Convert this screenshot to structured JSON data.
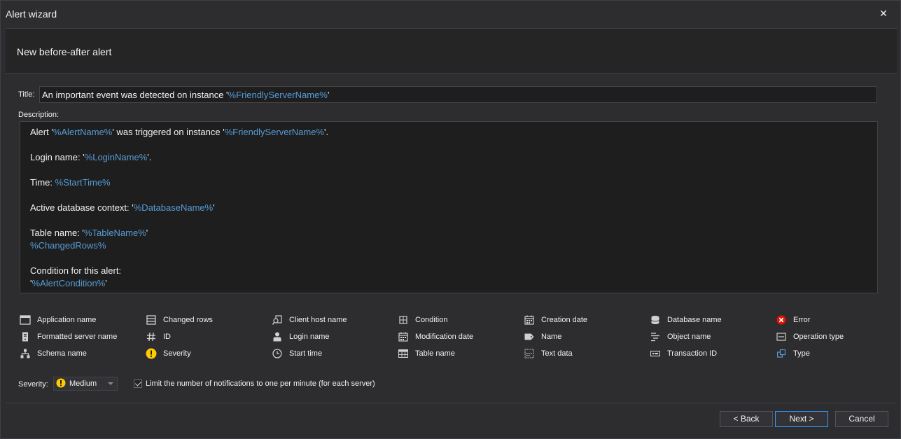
{
  "window": {
    "title": "Alert wizard",
    "close_glyph": "✕"
  },
  "header": {
    "title": "New before-after alert"
  },
  "form": {
    "title_label": "Title:",
    "title_value": [
      {
        "t": "An important event was detected on instance '"
      },
      {
        "t": "%FriendlyServerName%",
        "v": true
      },
      {
        "t": "'"
      }
    ],
    "description_label": "Description:",
    "description_lines": [
      [
        {
          "t": "Alert '"
        },
        {
          "t": "%AlertName%",
          "v": true
        },
        {
          "t": "' was triggered on instance '"
        },
        {
          "t": "%FriendlyServerName%",
          "v": true
        },
        {
          "t": "'."
        }
      ],
      [],
      [
        {
          "t": "Login name: '"
        },
        {
          "t": "%LoginName%",
          "v": true
        },
        {
          "t": "'."
        }
      ],
      [],
      [
        {
          "t": "Time: "
        },
        {
          "t": "%StartTime%",
          "v": true
        }
      ],
      [],
      [
        {
          "t": "Active database context: '"
        },
        {
          "t": "%DatabaseName%",
          "v": true
        },
        {
          "t": "'"
        }
      ],
      [],
      [
        {
          "t": "Table name: '"
        },
        {
          "t": "%TableName%",
          "v": true
        },
        {
          "t": "'"
        }
      ],
      [
        {
          "t": "%ChangedRows%",
          "v": true
        }
      ],
      [],
      [
        {
          "t": "Condition for this alert:"
        }
      ],
      [
        {
          "t": "'"
        },
        {
          "t": "%AlertCondition%",
          "v": true
        },
        {
          "t": "'"
        }
      ]
    ]
  },
  "tokens": [
    {
      "label": "Application name",
      "icon": "window-icon"
    },
    {
      "label": "Changed rows",
      "icon": "rows-icon"
    },
    {
      "label": "Client host name",
      "icon": "host-search-icon"
    },
    {
      "label": "Condition",
      "icon": "condition-icon"
    },
    {
      "label": "Creation date",
      "icon": "calendar-icon"
    },
    {
      "label": "Database name",
      "icon": "database-icon"
    },
    {
      "label": "Error",
      "icon": "error-icon"
    },
    {
      "label": "Formatted server name",
      "icon": "server-icon"
    },
    {
      "label": "ID",
      "icon": "hash-icon"
    },
    {
      "label": "Login name",
      "icon": "user-icon"
    },
    {
      "label": "Modification date",
      "icon": "calendar-icon"
    },
    {
      "label": "Name",
      "icon": "tag-icon"
    },
    {
      "label": "Object name",
      "icon": "object-icon"
    },
    {
      "label": "Operation type",
      "icon": "operation-icon"
    },
    {
      "label": "Schema name",
      "icon": "schema-icon"
    },
    {
      "label": "Severity",
      "icon": "warning-icon"
    },
    {
      "label": "Start time",
      "icon": "clock-icon"
    },
    {
      "label": "Table name",
      "icon": "table-icon"
    },
    {
      "label": "Text data",
      "icon": "text-data-icon"
    },
    {
      "label": "Transaction ID",
      "icon": "transaction-icon"
    },
    {
      "label": "Type",
      "icon": "type-icon"
    }
  ],
  "severity": {
    "label": "Severity:",
    "value": "Medium",
    "icon": "warning-icon"
  },
  "limit_checkbox": {
    "label": "Limit the number of notifications to one per minute (for each server)",
    "checked": true
  },
  "buttons": {
    "back": "< Back",
    "next": "Next >",
    "cancel": "Cancel"
  },
  "colors": {
    "background": "#2d2d30",
    "input_bg": "#1e1e1e",
    "variable": "#569cd6",
    "accent": "#3399ff",
    "warning": "#ffcc00",
    "error": "#e51400"
  }
}
